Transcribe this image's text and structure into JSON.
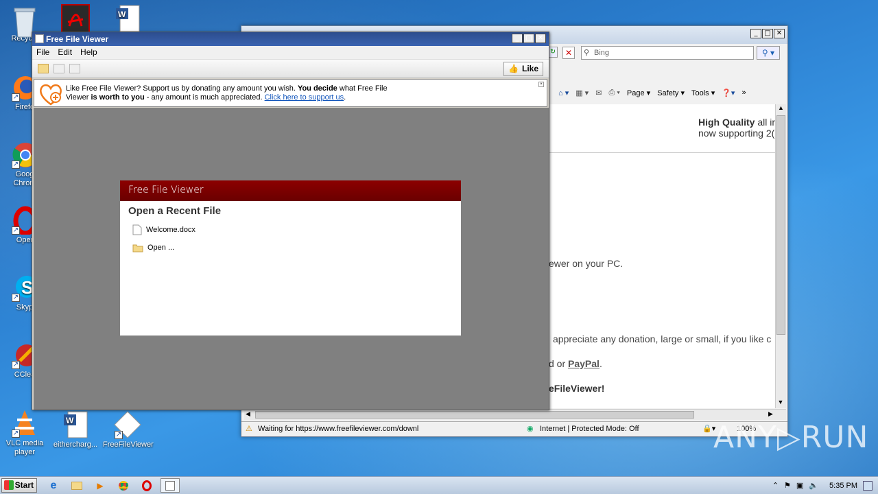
{
  "desktop": {
    "icons": [
      {
        "label": "Recycle",
        "icon": "recycle-bin-icon"
      },
      {
        "label": "Firefo",
        "icon": "firefox-icon"
      },
      {
        "label": "Goog\nChrom",
        "icon": "chrome-icon"
      },
      {
        "label": "Oper",
        "icon": "opera-icon"
      },
      {
        "label": "Skyp",
        "icon": "skype-icon"
      },
      {
        "label": "CClea",
        "icon": "ccleaner-icon"
      },
      {
        "label": "VLC media player",
        "icon": "vlc-icon"
      },
      {
        "label": "eithercharg...",
        "icon": "word-doc-icon"
      },
      {
        "label": "FreeFileViewer",
        "icon": "freefileviewer-icon"
      }
    ]
  },
  "ie": {
    "search_placeholder": "Bing",
    "commands": [
      "Page ▾",
      "Safety ▾",
      "Tools ▾"
    ],
    "content": {
      "hq_line1": "High Quality",
      "hq_line1_tail": "all ir",
      "hq_line2": "now supporting 2(",
      "viewer_text": "ewer on your PC.",
      "donation_text": "appreciate any donation, large or small, if you like c",
      "or_text": "d or",
      "paypal": "PayPal",
      "paypal_tail": ".",
      "final": "eFileViewer!"
    },
    "status_text": "Waiting for https://www.freefileviewer.com/downl",
    "zone_text": "Internet | Protected Mode: Off",
    "zoom_text": "100%"
  },
  "ffv": {
    "title": "Free File Viewer",
    "menu": [
      "File",
      "Edit",
      "Help"
    ],
    "like_label": "Like",
    "support": {
      "t1": "Like Free File Viewer? Support us by donating any amount you wish. ",
      "t2": "You decide",
      "t3": " what Free File",
      "t4": "Viewer ",
      "t5": "is worth to you",
      "t6": " - any amount is much appreciated. ",
      "link": "Click here to support us",
      "t7": "."
    },
    "panel": {
      "header": "Free File Viewer",
      "heading": "Open a Recent File",
      "files": [
        "Welcome.docx",
        "Open ..."
      ]
    }
  },
  "taskbar": {
    "start_label": "Start",
    "clock": "5:35 PM"
  },
  "watermark": "ANY▷RUN",
  "colors": {
    "ffv_header": "#8c0000",
    "link": "#1155bb",
    "titlebar": "#2c4d8e"
  }
}
